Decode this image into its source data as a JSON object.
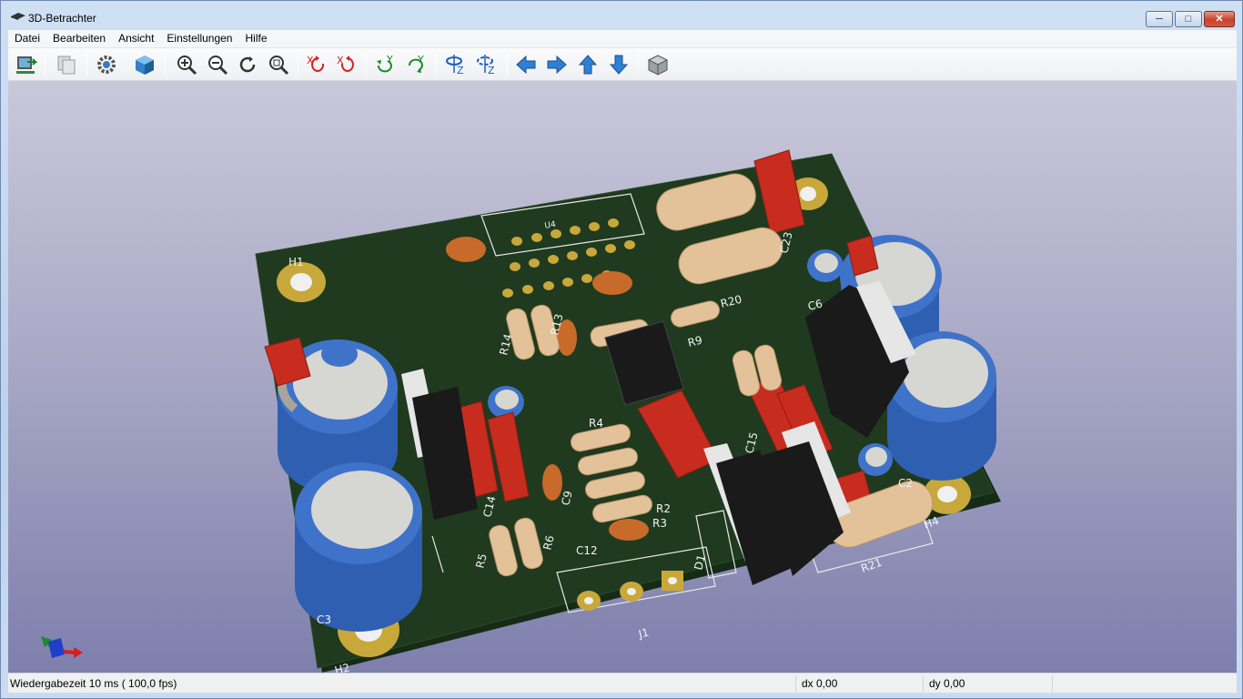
{
  "window": {
    "title": "3D-Betrachter",
    "buttons": {
      "minimize": "─",
      "maximize": "□",
      "close": "✕"
    }
  },
  "menu": [
    "Datei",
    "Bearbeiten",
    "Ansicht",
    "Einstellungen",
    "Hilfe"
  ],
  "toolbar": {
    "items": [
      "reload-board-icon",
      "copy-image-icon",
      "settings-icon",
      "3d-box-icon",
      "zoom-in-icon",
      "zoom-out-icon",
      "redraw-icon",
      "zoom-fit-icon",
      "rotate-x-cw-icon",
      "rotate-x-ccw-icon",
      "rotate-y-cw-icon",
      "rotate-y-ccw-icon",
      "rotate-z-cw-icon",
      "rotate-z-ccw-icon",
      "pan-left-icon",
      "pan-right-icon",
      "pan-up-icon",
      "pan-down-icon",
      "ortho-view-icon"
    ]
  },
  "board": {
    "labels": {
      "H1": "H1",
      "H2": "H2",
      "H4": "H4",
      "C2": "C2",
      "C3": "C3",
      "C6": "C6",
      "C9": "C9",
      "C12": "C12",
      "C14": "C14",
      "C15": "C15",
      "C23": "C23",
      "R2": "R2",
      "R3": "R3",
      "R4": "R4",
      "R5": "R5",
      "R6": "R6",
      "R9": "R9",
      "R13": "R13",
      "R14": "R14",
      "R20": "R20",
      "R21": "R21",
      "J1": "J1",
      "D1": "D1",
      "U4": "U4"
    },
    "colors": {
      "pcb": "#1f3a1f",
      "pad": "#c8a83a",
      "electrolytic": "#3f73c9",
      "film_cap": "#c72c1e",
      "resistor": "#e3c29a"
    }
  },
  "status": {
    "render_time": "Wiedergabezeit 10 ms ( 100,0 fps)",
    "dx": "dx 0,00",
    "dy": "dy 0,00"
  }
}
